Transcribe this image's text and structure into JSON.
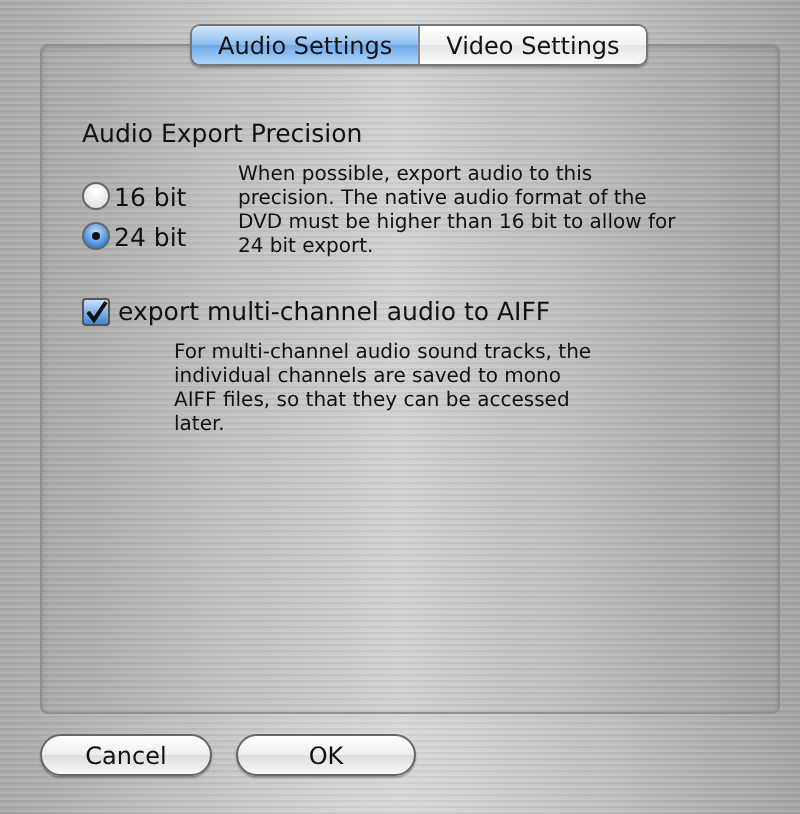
{
  "tabs": [
    {
      "label": "Audio Settings",
      "selected": true
    },
    {
      "label": "Video Settings",
      "selected": false
    }
  ],
  "section": {
    "heading": "Audio Export Precision",
    "options": [
      {
        "label": "16 bit",
        "selected": false
      },
      {
        "label": "24 bit",
        "selected": true
      }
    ],
    "description": "When possible, export audio to this precision.  The native audio format of the DVD must be higher than 16 bit to allow for 24 bit export."
  },
  "multichannel": {
    "label": "export multi-channel audio to AIFF",
    "checked": true,
    "description": "For multi-channel audio sound tracks, the individual channels are saved to mono AIFF files, so that they can be accessed later."
  },
  "buttons": [
    "Cancel",
    "OK"
  ]
}
